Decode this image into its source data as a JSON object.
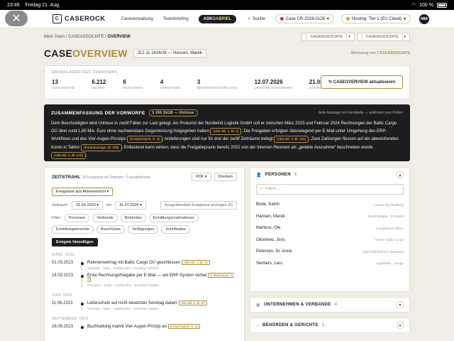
{
  "status_bar": {
    "time": "23:46",
    "date": "Freitag 21. Aug.",
    "battery": "100 %"
  },
  "nav": {
    "logo": "CASEROCK",
    "links": [
      "Caseverwaltung",
      "Teambriefing"
    ],
    "ask_prefix": "ASK",
    "ask_name": "GABRIEL",
    "search": "Suche",
    "case_pill": "Case CR-2026-0128",
    "hosting": "Hosting: Tier 1 (EU Cloud)",
    "avatar": "MM"
  },
  "breadcrumb": {
    "items": [
      "Mein Team",
      "CASEASSOCIATE",
      "OVERVIEW"
    ],
    "sel1": "CASEASSOCIATE",
    "sel2": "CASEASSOCIATE"
  },
  "header": {
    "title_a": "CASE",
    "title_b": "OVERVIEW",
    "case_ref": "312 Js 1424/26 — Hansen, Marek",
    "tool_prefix": "Werkzeug von CASE",
    "tool_suffix": "ASSOCIATE"
  },
  "overview": {
    "label": "GRUNDLAGEN DES OVERVIEWS",
    "stats": [
      {
        "n": "13",
        "s": "DOKUMENTE"
      },
      {
        "n": "6.212",
        "s": "SEITEN"
      },
      {
        "n": "6",
        "s": "PERSONEN"
      },
      {
        "n": "4",
        "s": "VERBÄNDE"
      },
      {
        "n": "3",
        "s": "BEHÖRDEN/GERICHTE"
      },
      {
        "n": "12.07.2026",
        "s": "LETZTES DOKUMENT"
      },
      {
        "n": "21.08.2026",
        "s": "OVERVIEW VOM"
      }
    ],
    "refresh": "CASEOVERVIEW aktualisieren"
  },
  "summary": {
    "heading": "ZUSAMMENFASSUNG DER VORWÜRFE",
    "tag": "§ 266 StGB — Untreue",
    "note": "Jede Aussage mit Fundstelle — anklicken zum Prüfen",
    "t1": "Dem Beschuldigten wird Untreue in zwölf Fällen zur Last gelegt. Als Prokurist der Nordwind Logistik GmbH soll er zwischen März 2023 und Februar 2024 Rechnungen der Baltic Cargo OÜ über rund 1,85 Mio. Euro ohne nachweisbare Gegenleistung freigegeben haben ",
    "r1": "(Akte Bd. 1, Bl. 1)",
    "t2": ". Die Freigaben erfolgten überwiegend per E-Mail unter Umgehung des ERP-Workflows und des Vier-Augen-Prinzips ",
    "r2": "(E-Mail-Export, S. 4)",
    "t3": "; Anlieferungen sind nur für drei der zwölf Zeiträume belegt ",
    "r3": "(Akte Bd. 2, Bl. 141)",
    "t4": ". Zwei Zahlungen flossen auf ein abweichendes Konto in Tallinn ",
    "r4": "(Kontoauszüge, Bl. 208)",
    "t5": ". Entlastend kann wirken, dass die Freigabepraxis bereits 2022 von der Internen Revision als „gelebte Ausnahme“ beschrieben wurde ",
    "r5": "(Akte Bd. 2, Bl. 210)",
    "t6": "."
  },
  "timeline": {
    "title": "ZEITSTRAHL",
    "sub": "15 Ereignisse im Zeitraum · 0 ausgeblendet",
    "pdf": "PDF ▾",
    "print": "Drucken",
    "events_btn": "Ereignisse aus Akteneinsicht ▾",
    "zeitraum": "Zeitraum:",
    "from": "01.03.2023 ▾",
    "bis": "bis",
    "to": "31.07.2026 ▾",
    "hidden": "Ausgeblendete Ereignisse anzeigen (0)",
    "filter_label": "Filter:",
    "filters": [
      "Personen",
      "Verbände",
      "Behörden",
      "Ermittlungsmaßnahmen",
      "Ermittlungsberichte",
      "Beschlüsse",
      "Verfügungen",
      "Schriftsätze"
    ],
    "add": "Ereignis hinzufügen",
    "groups": [
      {
        "month": "MÄRZ 2023",
        "events": [
          {
            "date": "01.03.2023",
            "text": "Rahmenvertrag mit Baltic Cargo OÜ geschlossen",
            "ref": "Akte Bd. 1, Bl. 12",
            "actions": "Verbinde · Notiz · Ausblenden · Korrektur melden"
          },
          {
            "date": "14.03.2023",
            "text": "Erste Rechnungsfreigabe per E-Mail — am ERP-System vorbei",
            "ref": "E-Mail-Export, S. 3",
            "actions": "Personen · Notiz · Ausblenden · Korrektur melden"
          }
        ]
      },
      {
        "month": "JUNI 2023",
        "events": [
          {
            "date": "11.06.2023",
            "text": "Lieferschein auf nicht besetzten Sonntag datiert",
            "ref": "Akte Bd. 2, Bl. 87",
            "actions": "Verbinde · Notiz · Ausblenden · Korrektur melden"
          }
        ]
      },
      {
        "month": "SEPTEMBER 2023",
        "events": [
          {
            "date": "28.09.2023",
            "text": "Buchhaltung mahnt Vier-Augen-Prinzip an",
            "ref": "E-Mail-Export, S. 41",
            "actions": ""
          }
        ]
      }
    ]
  },
  "persons": {
    "title": "PERSONEN",
    "count": "6",
    "filter": "Filtern ...",
    "rows": [
      {
        "name": "Bode, Katrin",
        "role": "Leiterin Buchhaltung"
      },
      {
        "name": "Hansen, Marek",
        "role": "Beschuldigter · Prokurist"
      },
      {
        "name": "Martens, Ole",
        "role": "Compliance Officer"
      },
      {
        "name": "Okonkwo, Jens",
        "role": "Fahrer Baltic Cargo"
      },
      {
        "name": "Petersen, Dr. Anna",
        "role": "Geschäftsführerin Nordwind"
      },
      {
        "name": "Siemers, Lars",
        "role": "Lagerleiter · Zeuge"
      }
    ]
  },
  "companies": {
    "title": "UNTERNEHMEN & VERBÄNDE",
    "count": "4"
  },
  "authorities": {
    "title": "BEHÖRDEN & GERICHTE",
    "count": "3"
  }
}
